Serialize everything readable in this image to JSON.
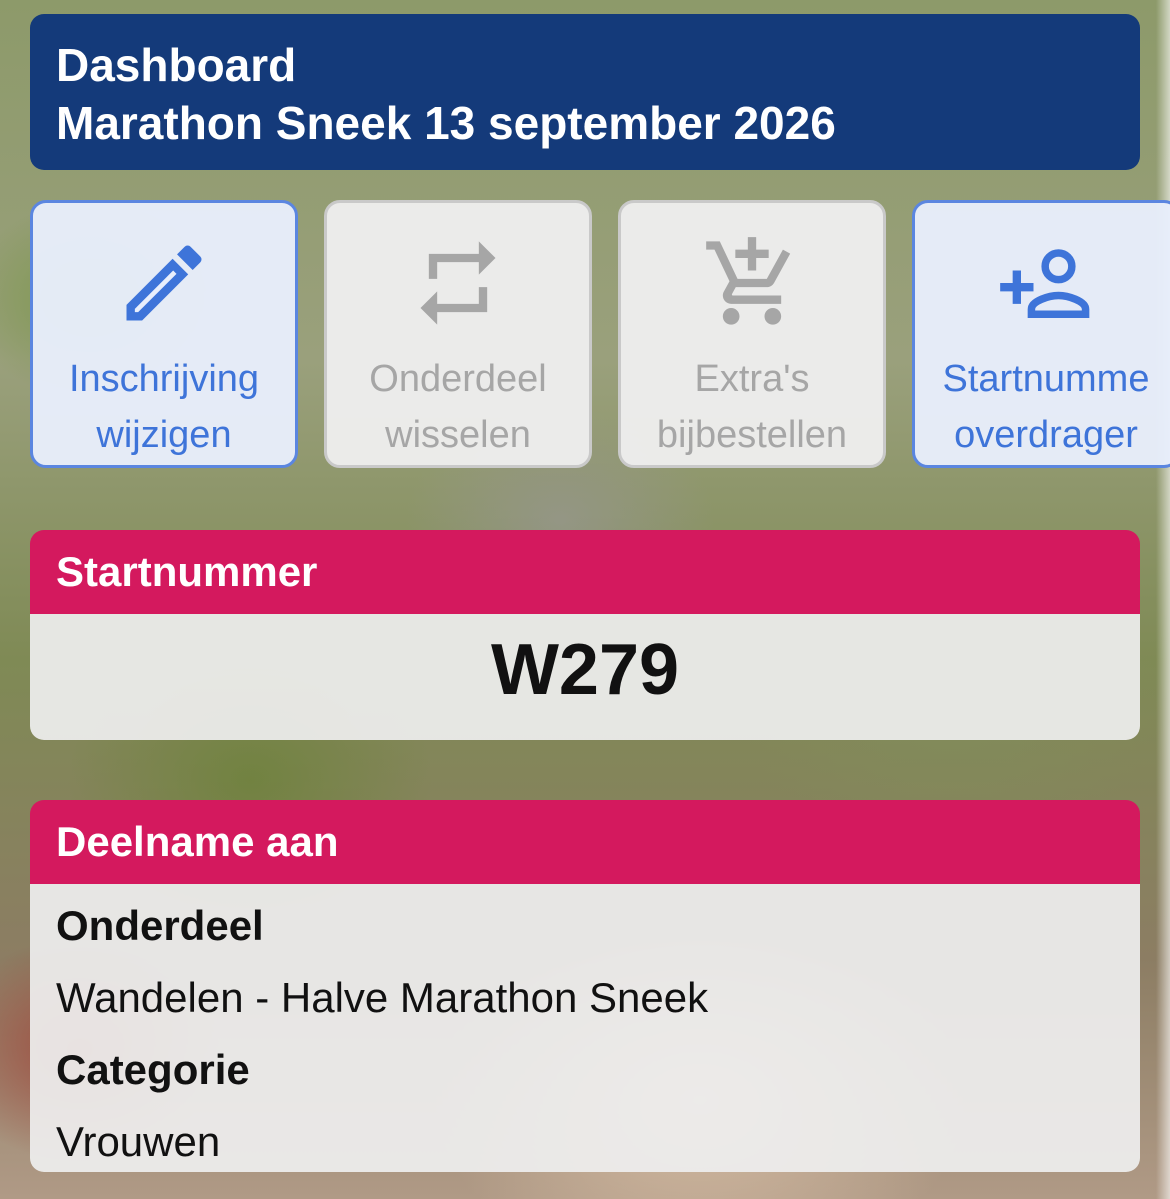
{
  "header": {
    "title": "Dashboard",
    "subtitle": "Marathon Sneek 13 september 2026"
  },
  "actions": [
    {
      "line1": "Inschrijving",
      "line2": "wijzigen",
      "icon": "pencil-icon",
      "state": "enabled"
    },
    {
      "line1": "Onderdeel",
      "line2": "wisselen",
      "icon": "swap-icon",
      "state": "disabled"
    },
    {
      "line1": "Extra's",
      "line2": "bijbestellen",
      "icon": "cart-add-icon",
      "state": "disabled"
    },
    {
      "line1": "Startnumme",
      "line2": "overdrager",
      "icon": "add-person-icon",
      "state": "enabled"
    }
  ],
  "startnummer": {
    "heading": "Startnummer",
    "value": "W279"
  },
  "deelname": {
    "heading": "Deelname aan",
    "onderdeel_label": "Onderdeel",
    "onderdeel_value": "Wandelen - Halve Marathon Sneek",
    "categorie_label": "Categorie",
    "categorie_value": "Vrouwen"
  },
  "colors": {
    "header_bg": "#143a7a",
    "card_header_bg": "#d4195e",
    "action_enabled": "#3e74d9",
    "action_disabled": "#a6a6a6"
  }
}
